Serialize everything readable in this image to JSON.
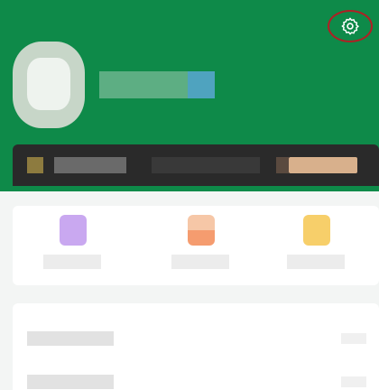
{
  "theme": {
    "brand_color": "#0e8a49",
    "highlight_color": "#b01f24"
  },
  "header": {
    "settings_icon": "gear-icon",
    "avatar": "avatar",
    "username": "",
    "vip_badge": "vip-badge-icon"
  },
  "member_strip": {
    "title": "",
    "promo": ""
  },
  "quick_actions": [
    {
      "icon": "purple-action-icon",
      "label": ""
    },
    {
      "icon": "orange-action-icon",
      "label": ""
    },
    {
      "icon": "yellow-action-icon",
      "label": ""
    }
  ],
  "list": [
    {
      "label": ""
    },
    {
      "label": ""
    }
  ]
}
